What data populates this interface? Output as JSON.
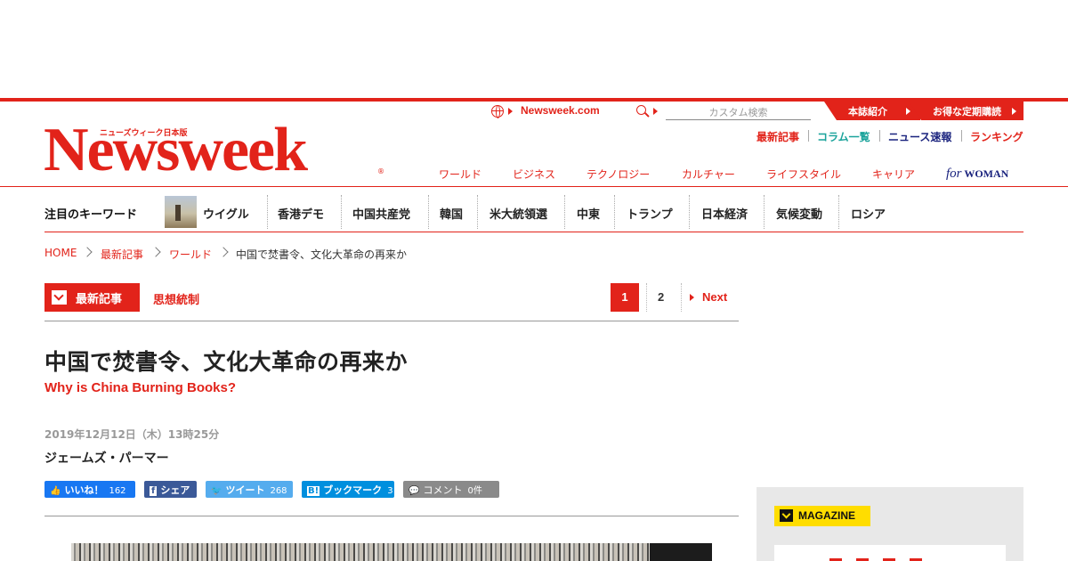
{
  "header": {
    "site_link": "Newsweek.com",
    "search_placeholder": "カスタム検索",
    "tab_about": "本誌紹介",
    "tab_subscribe": "お得な定期購読",
    "util_links": [
      "最新記事",
      "コラム一覧",
      "ニュース速報",
      "ランキング"
    ],
    "logo_text": "Newsweek",
    "logo_sub": "ニューズウィーク日本版",
    "logo_reg": "®",
    "nav": [
      "ワールド",
      "ビジネス",
      "テクノロジー",
      "カルチャー",
      "ライフスタイル",
      "キャリア"
    ],
    "for_woman_prefix": "for",
    "for_woman": "WOMAN",
    "colors": {
      "brand_red": "#e2231a",
      "woman_navy": "#1a237e"
    }
  },
  "keywords": {
    "title": "注目のキーワード",
    "items": [
      "ウイグル",
      "香港デモ",
      "中国共産党",
      "韓国",
      "米大統領選",
      "中東",
      "トランプ",
      "日本経済",
      "気候変動",
      "ロシア"
    ]
  },
  "breadcrumb": [
    "HOME",
    "最新記事",
    "ワールド",
    "中国で焚書令、文化大革命の再来か"
  ],
  "section": {
    "tag": "最新記事",
    "sub": "思想統制",
    "pages": [
      "1",
      "2"
    ],
    "current_page": "1",
    "next": "Next"
  },
  "article": {
    "headline": "中国で焚書令、文化大革命の再来か",
    "subhead": "Why is China Burning Books?",
    "date": "2019年12月12日（木）13時25分",
    "author": "ジェームズ・パーマー"
  },
  "share": {
    "like": {
      "label": "いいね！",
      "count": "162",
      "color": "#1877f2"
    },
    "fb_share": {
      "label": "シェア",
      "color": "#3b5998"
    },
    "tweet": {
      "label": "ツイート",
      "count": "268",
      "color": "#55acee"
    },
    "hatena": {
      "label": "ブックマーク",
      "count": "3",
      "color": "#008fde"
    },
    "comment": {
      "label": "コメント",
      "count": "0件",
      "color": "#8a8a8a"
    }
  },
  "sidebar": {
    "magazine_label": "MAGAZINE"
  }
}
